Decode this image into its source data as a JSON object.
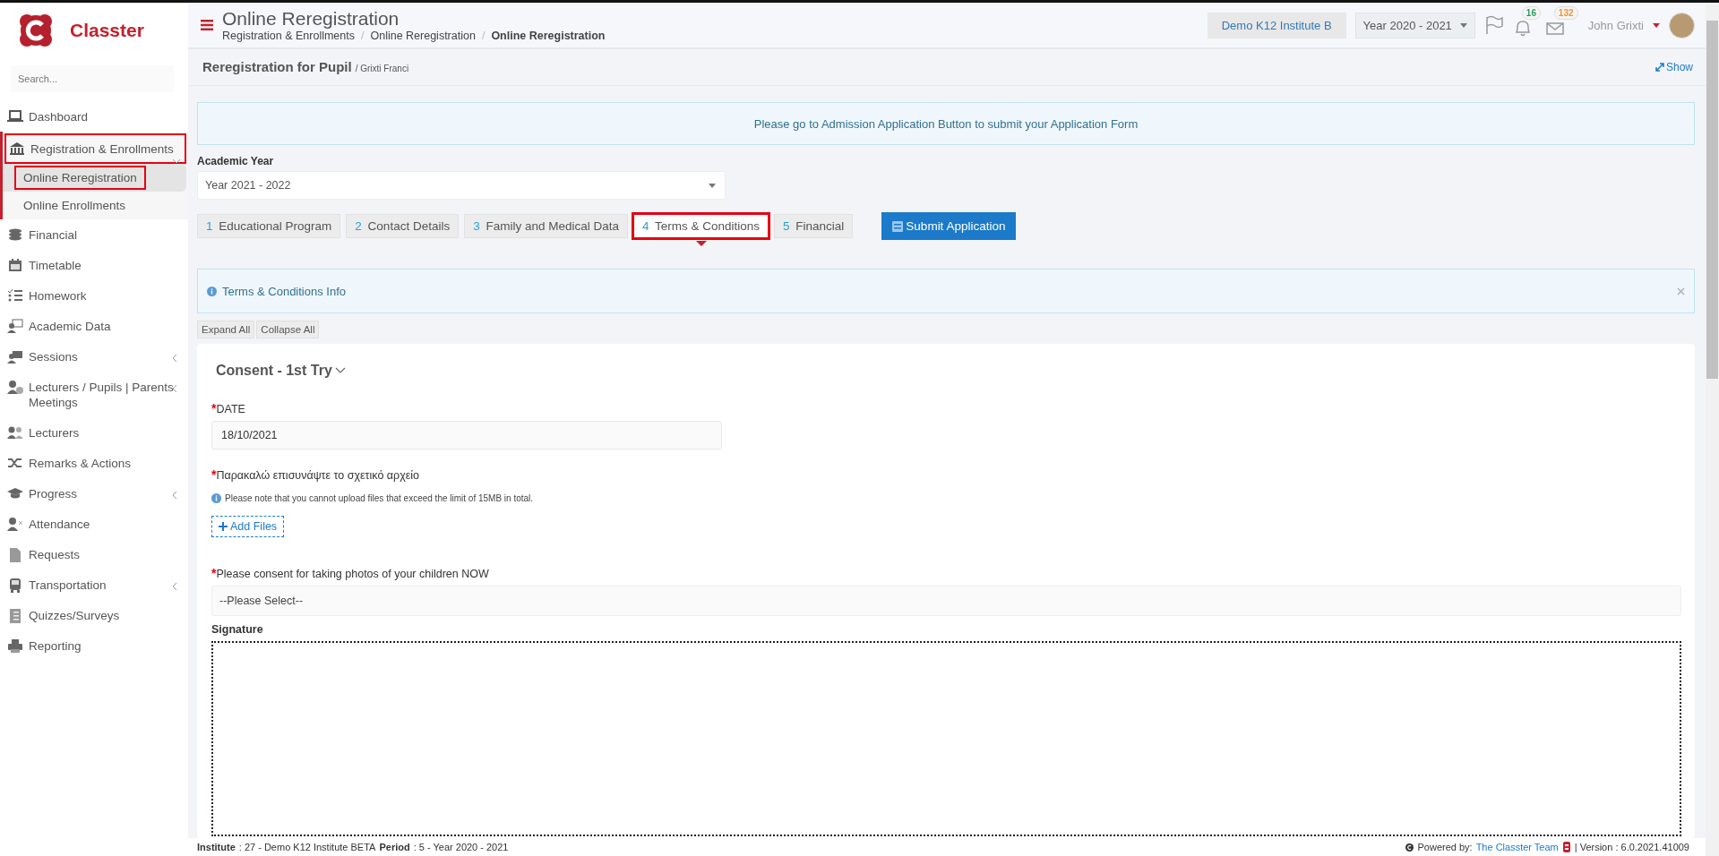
{
  "brand": {
    "name": "Classter"
  },
  "sidebar": {
    "search": {
      "placeholder": "Search..."
    },
    "items": [
      {
        "label": "Dashboard",
        "expandable": false,
        "selected": false,
        "highlighted": false
      },
      {
        "label": "Registration & Enrollments",
        "expandable": true,
        "selected": true,
        "highlighted": true,
        "children": [
          {
            "label": "Online Reregistration",
            "selected": true,
            "highlighted": true
          },
          {
            "label": "Online Enrollments",
            "selected": false,
            "highlighted": false
          }
        ]
      },
      {
        "label": "Financial",
        "expandable": false,
        "selected": false,
        "highlighted": false
      },
      {
        "label": "Timetable",
        "expandable": false,
        "selected": false,
        "highlighted": false
      },
      {
        "label": "Homework",
        "expandable": false,
        "selected": false,
        "highlighted": false
      },
      {
        "label": "Academic Data",
        "expandable": false,
        "selected": false,
        "highlighted": false
      },
      {
        "label": "Sessions",
        "expandable": true,
        "selected": false,
        "highlighted": false
      },
      {
        "label": "Lecturers / Pupils | Parents Meetings",
        "expandable": true,
        "selected": false,
        "highlighted": false
      },
      {
        "label": "Lecturers",
        "expandable": false,
        "selected": false,
        "highlighted": false
      },
      {
        "label": "Remarks & Actions",
        "expandable": false,
        "selected": false,
        "highlighted": false
      },
      {
        "label": "Progress",
        "expandable": true,
        "selected": false,
        "highlighted": false
      },
      {
        "label": "Attendance",
        "expandable": false,
        "selected": false,
        "highlighted": false
      },
      {
        "label": "Requests",
        "expandable": false,
        "selected": false,
        "highlighted": false
      },
      {
        "label": "Transportation",
        "expandable": true,
        "selected": false,
        "highlighted": false
      },
      {
        "label": "Quizzes/Surveys",
        "expandable": false,
        "selected": false,
        "highlighted": false
      },
      {
        "label": "Reporting",
        "expandable": false,
        "selected": false,
        "highlighted": false
      }
    ]
  },
  "header": {
    "title": "Online Reregistration",
    "breadcrumb": [
      {
        "label": "Registration & Enrollments",
        "current": false
      },
      {
        "separator": "/",
        "label": "Online Reregistration",
        "current": false
      },
      {
        "separator": "/",
        "label": "Online Reregistration",
        "current": true
      }
    ],
    "institute": "Demo K12 Institute B",
    "year": "Year 2020 - 2021",
    "notifications": "16",
    "messages": "132",
    "user": "John Grixti"
  },
  "subheader": {
    "title": "Reregistration for Pupil",
    "subtitle": "/ Grixti Franci",
    "action": "Show"
  },
  "notice": "Please go to Admission Application Button to submit your Application Form",
  "academic_year": {
    "label": "Academic Year",
    "value": "Year 2021 - 2022"
  },
  "tabs": [
    {
      "number": "1",
      "label": "Educational Program",
      "selected": false,
      "highlighted": false
    },
    {
      "number": "2",
      "label": "Contact Details",
      "selected": false,
      "highlighted": false
    },
    {
      "number": "3",
      "label": "Family and Medical Data",
      "selected": false,
      "highlighted": false
    },
    {
      "number": "4",
      "label": "Terms & Conditions",
      "selected": true,
      "highlighted": true
    },
    {
      "number": "5",
      "label": "Financial",
      "selected": false,
      "highlighted": false
    }
  ],
  "submit_button": "Submit Application",
  "info_panel": {
    "title": "Terms & Conditions Info"
  },
  "toolbar": [
    "Expand All",
    "Collapse All"
  ],
  "section": {
    "title": "Consent - 1st Try",
    "fields": [
      {
        "kind": "date",
        "required_mark": "*",
        "label": "DATE",
        "value": "18/10/2021"
      },
      {
        "kind": "upload",
        "required_mark": "*",
        "label": "Παρακαλώ επισυνάψτε το σχετικό αρχείο",
        "note": "Please note that you cannot upload files that exceed the limit of 15MB in total.",
        "button": "Add Files"
      },
      {
        "kind": "select",
        "required_mark": "*",
        "label": "Please consent for taking photos of your children NOW",
        "value": "--Please Select--"
      },
      {
        "kind": "signature",
        "label": "Signature"
      }
    ]
  },
  "footer": {
    "institute_label": "Institute",
    "institute": ": 27 - Demo K12 Institute BETA",
    "period_label": "Period",
    "period": ": 5 - Year 2020 - 2021",
    "powered": "Powered by:",
    "team": "The Classter Team",
    "version": "| Version : 6.0.2021.41009"
  }
}
